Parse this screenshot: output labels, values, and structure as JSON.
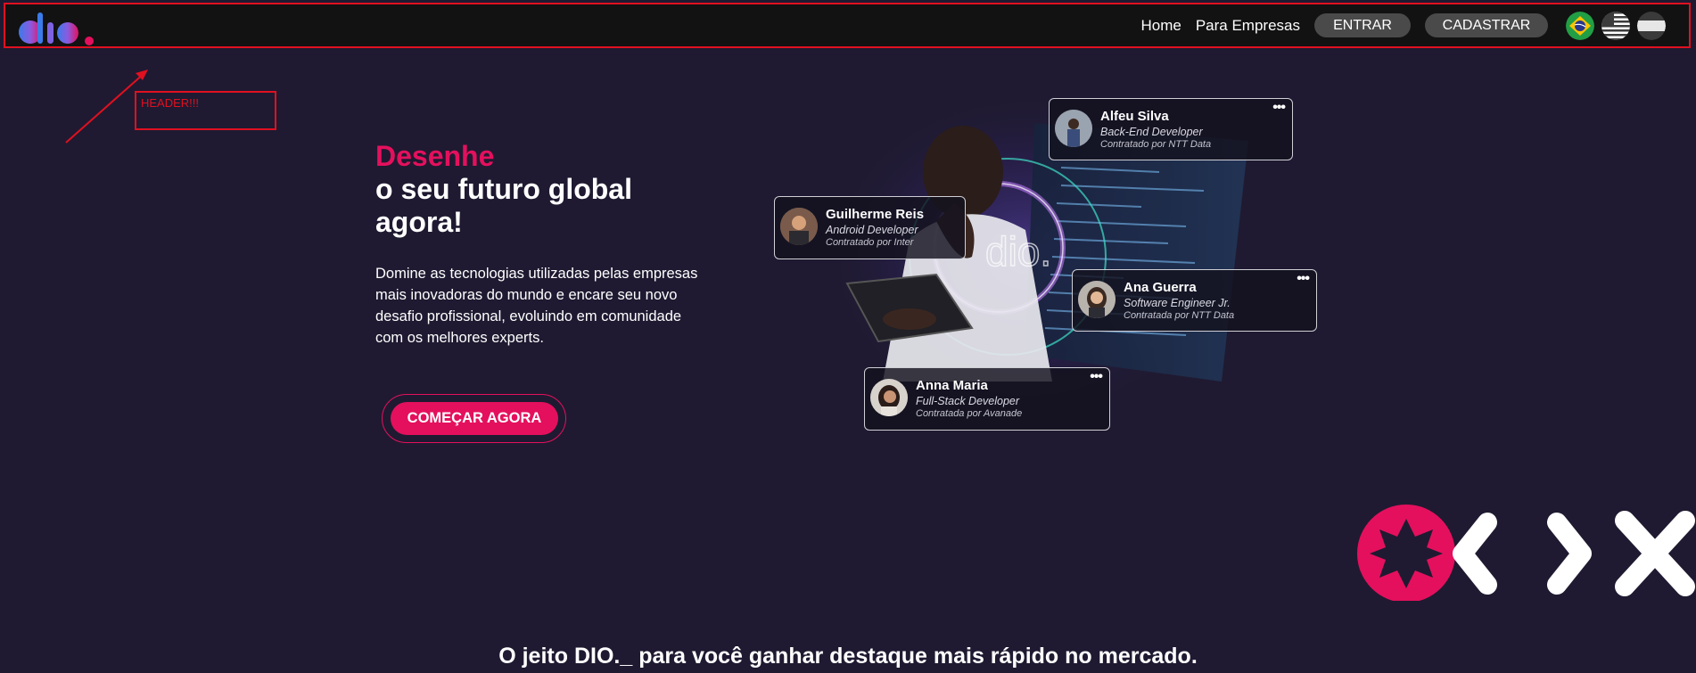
{
  "header": {
    "nav": {
      "home": "Home",
      "empresas": "Para Empresas",
      "entrar": "ENTRAR",
      "cadastrar": "CADASTRAR"
    },
    "flags": [
      "brazil-flag-icon",
      "usa-flag-icon",
      "spain-flag-icon"
    ]
  },
  "annotation": {
    "label": "HEADER!!!"
  },
  "hero": {
    "title_accent": "Desenhe",
    "title_main": "o seu futuro global agora!",
    "description": "Domine as tecnologias utilizadas pelas empresas mais inovadoras do mundo e encare seu novo desafio profissional, evoluindo em comunidade com os melhores experts.",
    "cta": "COMEÇAR AGORA"
  },
  "cards": [
    {
      "name": "Alfeu Silva",
      "role": "Back-End Developer",
      "hired": "Contratado por NTT Data"
    },
    {
      "name": "Guilherme Reis",
      "role": "Android Developer",
      "hired": "Contratado por Inter"
    },
    {
      "name": "Ana Guerra",
      "role": "Software Engineer Jr.",
      "hired": "Contratada por NTT Data"
    },
    {
      "name": "Anna Maria",
      "role": "Full-Stack Developer",
      "hired": "Contratada por Avanade"
    }
  ],
  "tagline": "O jeito DIO._ para você ganhar destaque mais rápido no mercado.",
  "colors": {
    "background": "#1f1a31",
    "accent": "#e4105d",
    "header": "#121212",
    "annotation": "#e01020"
  }
}
